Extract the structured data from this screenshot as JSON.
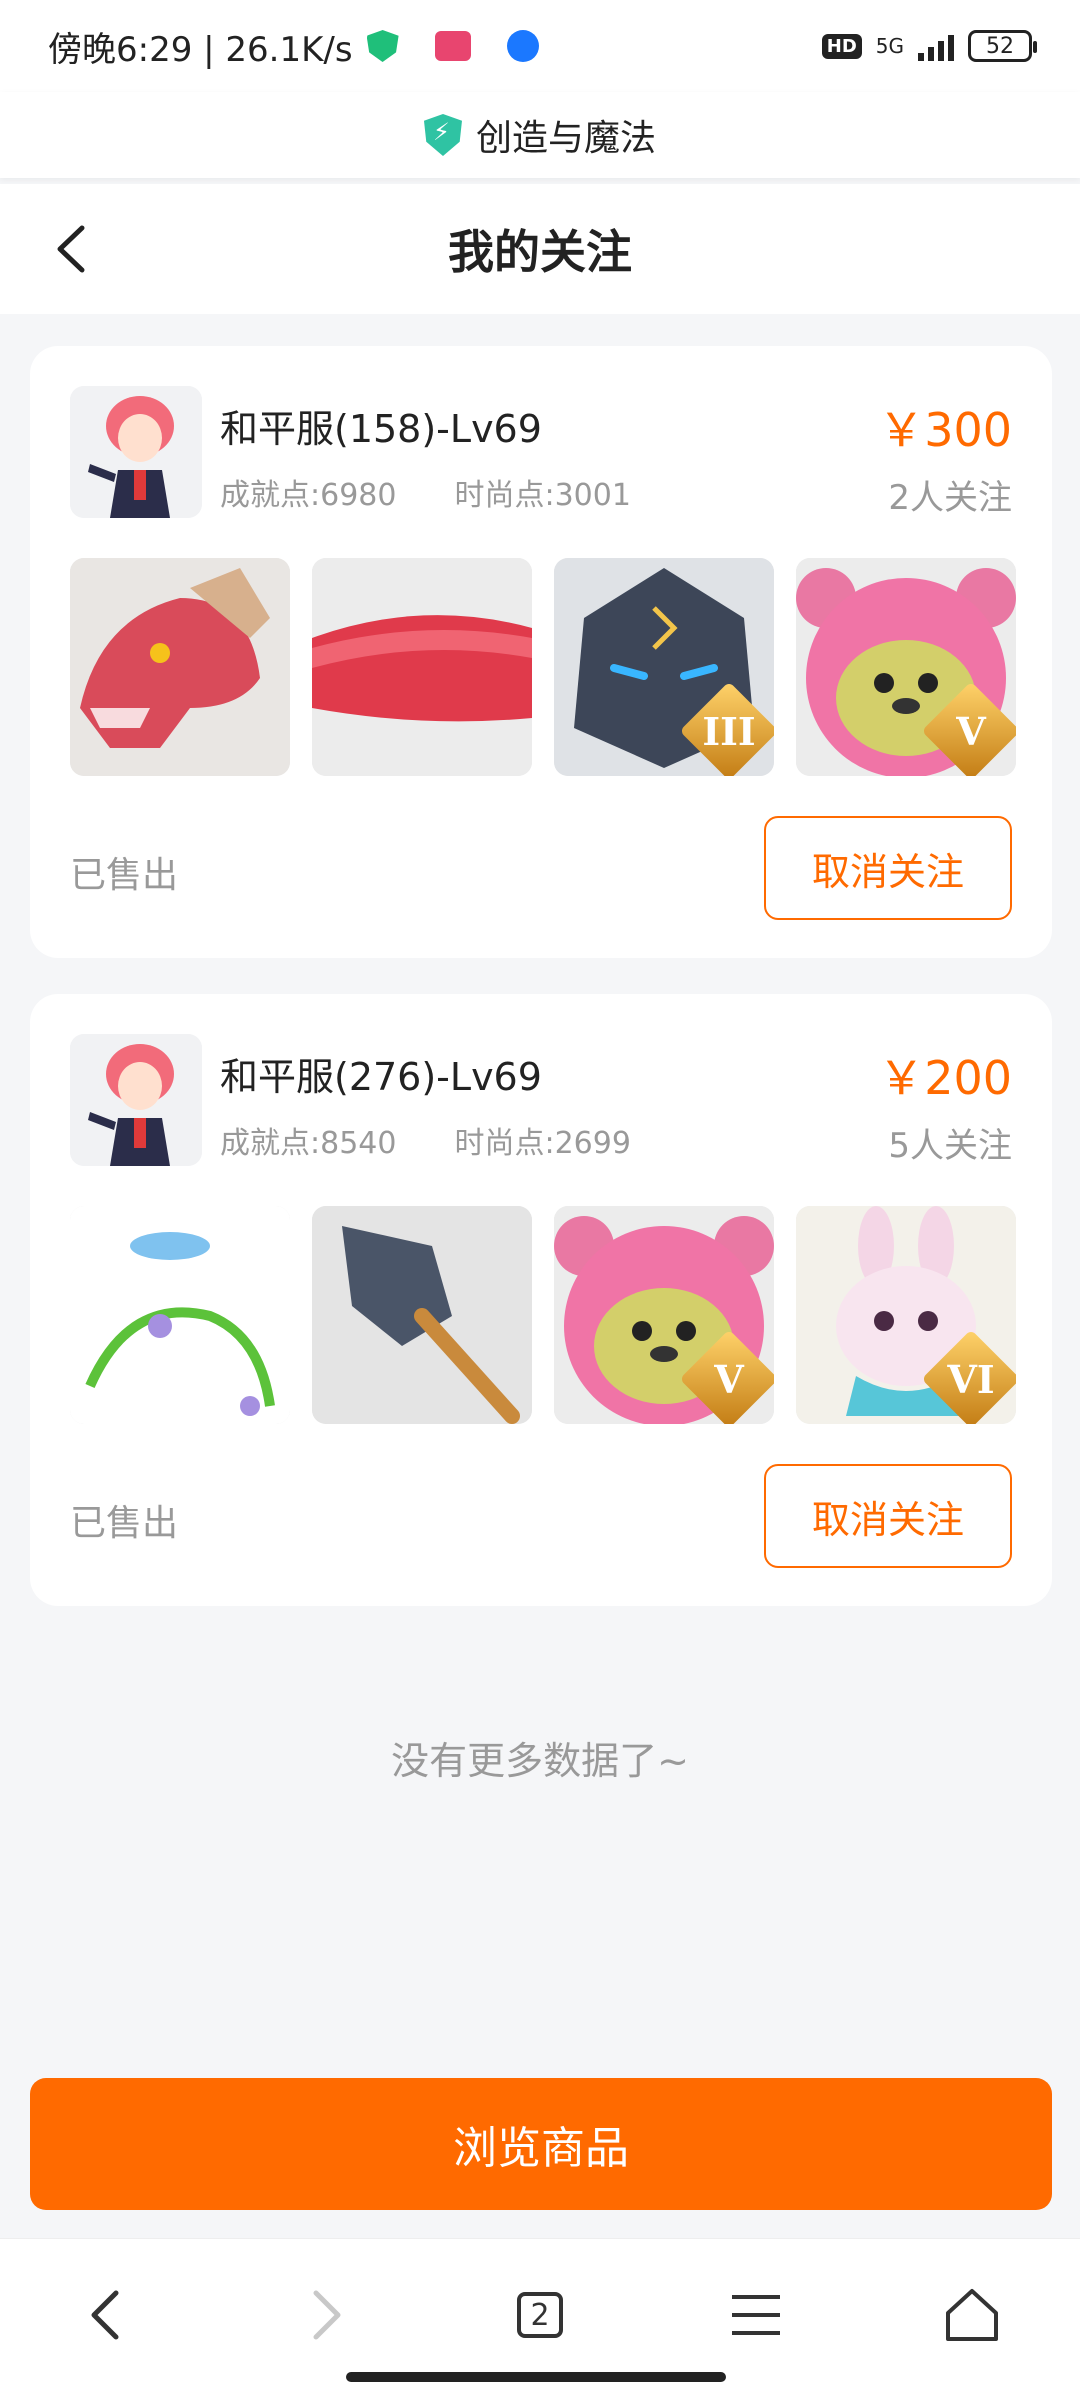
{
  "status_bar": {
    "time_speed": "傍晚6:29 | 26.1K/s",
    "network": "5G",
    "hd": "HD",
    "battery": "52"
  },
  "site": {
    "title": "创造与魔法"
  },
  "nav": {
    "title": "我的关注"
  },
  "cards": [
    {
      "server": "和平服(158)-Lv69",
      "achievement": "成就点:6980",
      "fashion": "时尚点:3001",
      "price": "￥300",
      "followers": "2人关注",
      "status": "已售出",
      "unfollow_label": "取消关注",
      "items": [
        {
          "name": "red-dragon-head",
          "rank": ""
        },
        {
          "name": "red-tube",
          "rank": ""
        },
        {
          "name": "stone-golem",
          "rank": "III"
        },
        {
          "name": "pink-bear",
          "rank": "V"
        }
      ]
    },
    {
      "server": "和平服(276)-Lv69",
      "achievement": "成就点:8540",
      "fashion": "时尚点:2699",
      "price": "￥200",
      "followers": "5人关注",
      "status": "已售出",
      "unfollow_label": "取消关注",
      "items": [
        {
          "name": "bird-vine-wreath",
          "rank": ""
        },
        {
          "name": "shovel",
          "rank": ""
        },
        {
          "name": "pink-bear",
          "rank": "V"
        },
        {
          "name": "rabbit",
          "rank": "VI"
        }
      ]
    }
  ],
  "no_more": "没有更多数据了~",
  "browse_label": "浏览商品",
  "bottom_nav": {
    "tab_count": "2"
  },
  "colors": {
    "accent": "#ff6a00",
    "muted": "#999999",
    "background": "#f5f6f8"
  }
}
